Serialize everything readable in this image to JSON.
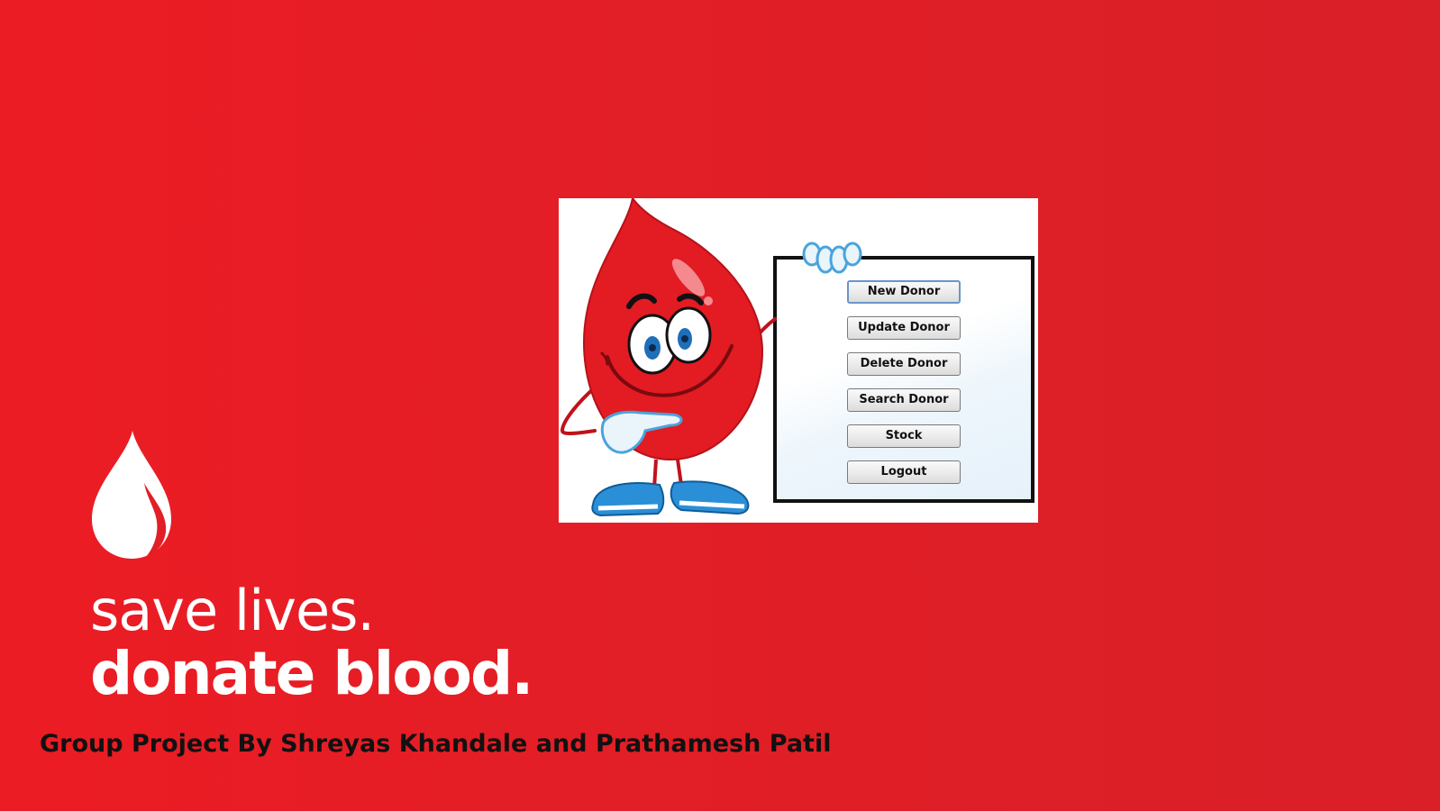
{
  "colors": {
    "background": "#e21e26",
    "text_light": "#ffffff",
    "text_dark": "#111111",
    "mascot_red": "#e31b23",
    "shoe_blue": "#2a8fd6"
  },
  "branding": {
    "logo_icon": "blood-drop-icon",
    "tagline_line1": "save lives.",
    "tagline_line2": "donate blood.",
    "credits": "Group Project By Shreyas Khandale and Prathamesh Patil"
  },
  "app_menu": {
    "mascot_icon": "blood-drop-mascot",
    "buttons": [
      {
        "id": "new-donor",
        "label": "New Donor",
        "focused": true
      },
      {
        "id": "update-donor",
        "label": "Update Donor"
      },
      {
        "id": "delete-donor",
        "label": "Delete Donor"
      },
      {
        "id": "search-donor",
        "label": "Search Donor"
      },
      {
        "id": "stock",
        "label": "Stock"
      },
      {
        "id": "logout",
        "label": "Logout"
      }
    ]
  }
}
